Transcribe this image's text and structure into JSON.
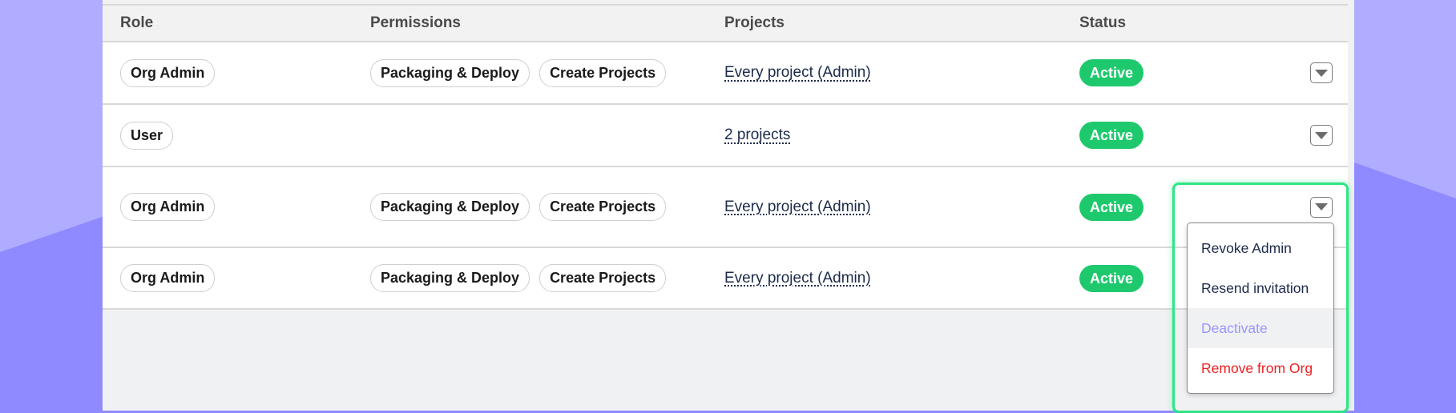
{
  "table": {
    "columns": [
      "Role",
      "Permissions",
      "Projects",
      "Status",
      ""
    ],
    "rows": [
      {
        "role": "Org Admin",
        "permissions": [
          "Packaging & Deploy",
          "Create Projects"
        ],
        "projects": "Every project (Admin)",
        "status": "Active"
      },
      {
        "role": "User",
        "permissions": [],
        "projects": "2 projects",
        "status": "Active"
      },
      {
        "role": "Org Admin",
        "permissions": [
          "Packaging & Deploy",
          "Create Projects"
        ],
        "projects": "Every project (Admin)",
        "status": "Active"
      },
      {
        "role": "Org Admin",
        "permissions": [
          "Packaging & Deploy",
          "Create Projects"
        ],
        "projects": "Every project (Admin)",
        "status": "Active"
      }
    ]
  },
  "actions_menu": {
    "open_for_row": 3,
    "items": [
      {
        "label": "Revoke Admin",
        "state": "normal"
      },
      {
        "label": "Resend invitation",
        "state": "normal"
      },
      {
        "label": "Deactivate",
        "state": "hover"
      },
      {
        "label": "Remove from Org",
        "state": "danger"
      }
    ]
  },
  "icons": {
    "row_action": "caret-down-icon"
  },
  "colors": {
    "status_active": "#1ec96d",
    "highlight": "#2ee584",
    "danger": "#ee2020",
    "hover_text": "#9b95ff",
    "background_light": "#b0acff",
    "background_dark": "#8f8aff"
  }
}
